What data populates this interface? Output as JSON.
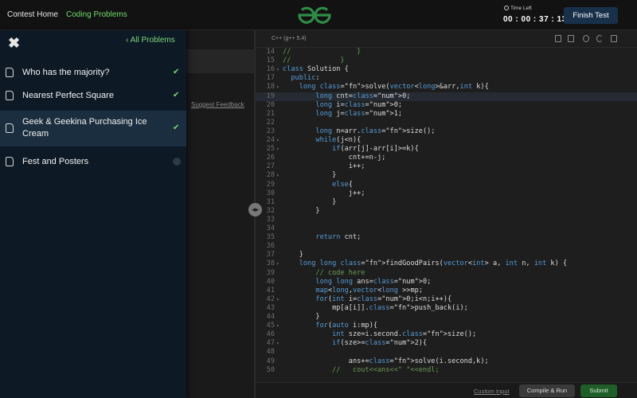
{
  "topbar": {
    "contest_home": "Contest Home",
    "coding_problems": "Coding Problems",
    "logo_text": "GfG",
    "time_left_label": "Time Left",
    "time_left_value": "00 : 00 : 37 : 13",
    "finish_label": "Finish Test"
  },
  "sidebar": {
    "all_problems": "All Problems",
    "problems": [
      {
        "title": "Who has the majority?",
        "solved": true
      },
      {
        "title": "Nearest Perfect Square",
        "solved": true
      },
      {
        "title": "Geek & Geekina Purchasing Ice Cream",
        "solved": true
      },
      {
        "title": "Fest and Posters",
        "solved": false
      }
    ]
  },
  "background": {
    "suggest_feedback": "Suggest Feedback"
  },
  "editor": {
    "language": "C++ (g++ 5.4)",
    "first_line": 14,
    "lines": [
      "//                }",
      "//            }",
      "class Solution {",
      "  public:",
      "    long solve(vector<long>&arr,int k){",
      "        long cnt=0;",
      "        long i=0;",
      "        long j=1;",
      "",
      "        long n=arr.size();",
      "        while(j<n){",
      "            if(arr[j]-arr[i]>=k){",
      "                cnt+=n-j;",
      "                i++;",
      "            }",
      "            else{",
      "                j++;",
      "            }",
      "        }",
      "",
      "",
      "        return cnt;",
      "",
      "    }",
      "    long long findGoodPairs(vector<int> a, int n, int k) {",
      "        // code here",
      "        long long ans=0;",
      "        map<long,vector<long >>mp;",
      "        for(int i=0;i<n;i++){",
      "            mp[a[i]].push_back(i);",
      "        }",
      "        for(auto i:mp){",
      "            int sze=i.second.size();",
      "            if(sze>=2){",
      "",
      "                ans+=solve(i.second,k);",
      "            //   cout<<ans<<\" \"<<endl;"
    ],
    "fold_lines": [
      16,
      18,
      24,
      25,
      28,
      38,
      42,
      45,
      47
    ],
    "active_line": 19,
    "custom_input": "Custom Input",
    "compile_label": "Compile & Run",
    "submit_label": "Submit"
  },
  "colors": {
    "accent_green": "#7ed47a",
    "finish_bg": "#19304a",
    "overlay_bg": "#0d1a26",
    "submit_bg": "#1f5e28"
  },
  "icons": [
    "close-icon",
    "chevron-left-icon",
    "document-icon",
    "check-icon",
    "clock-icon",
    "copy-icon",
    "file-icon",
    "gear-icon",
    "refresh-icon",
    "expand-icon",
    "splitter-handle-icon"
  ]
}
